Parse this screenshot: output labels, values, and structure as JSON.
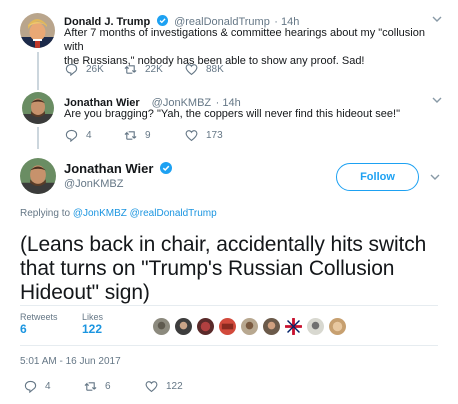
{
  "tweets": [
    {
      "name": "Donald J. Trump",
      "handle": "@realDonaldTrump",
      "time": "14h",
      "text_line1": "After 7 months of investigations & committee hearings about my \"collusion with",
      "text_line2": "the Russians,\" nobody has been able to show any proof. Sad!",
      "replies": "26K",
      "retweets": "22K",
      "likes": "88K"
    },
    {
      "name": "Jonathan Wier",
      "handle": "@JonKMBZ",
      "time": "14h",
      "text_line1": "Are you bragging? \"Yah, the coppers will never find this hideout see!\"",
      "replies": "4",
      "retweets": "9",
      "likes": "173"
    }
  ],
  "main_tweet": {
    "name": "Jonathan Wier",
    "handle": "@JonKMBZ",
    "follow_label": "Follow",
    "replying_prefix": "Replying to",
    "replying_to": "@JonKMBZ @realDonaldTrump",
    "text_line1": "(Leans back in chair, accidentally hits switch",
    "text_line2": "that turns on \"Trump's Russian Collusion",
    "text_line3": "Hideout\" sign)",
    "retweets_label": "Retweets",
    "retweets_count": "6",
    "likes_label": "Likes",
    "likes_count": "122",
    "timestamp": "5:01 AM - 16 Jun 2017",
    "replies": "4",
    "retweets": "6",
    "likes": "122"
  },
  "colors": {
    "accent": "#1da1f2",
    "link": "#1b95e0",
    "muted": "#657786",
    "divider": "#e6ecf0"
  },
  "icons": [
    "verified-badge-icon",
    "chevron-down-icon",
    "reply-icon",
    "retweet-icon",
    "heart-icon"
  ]
}
